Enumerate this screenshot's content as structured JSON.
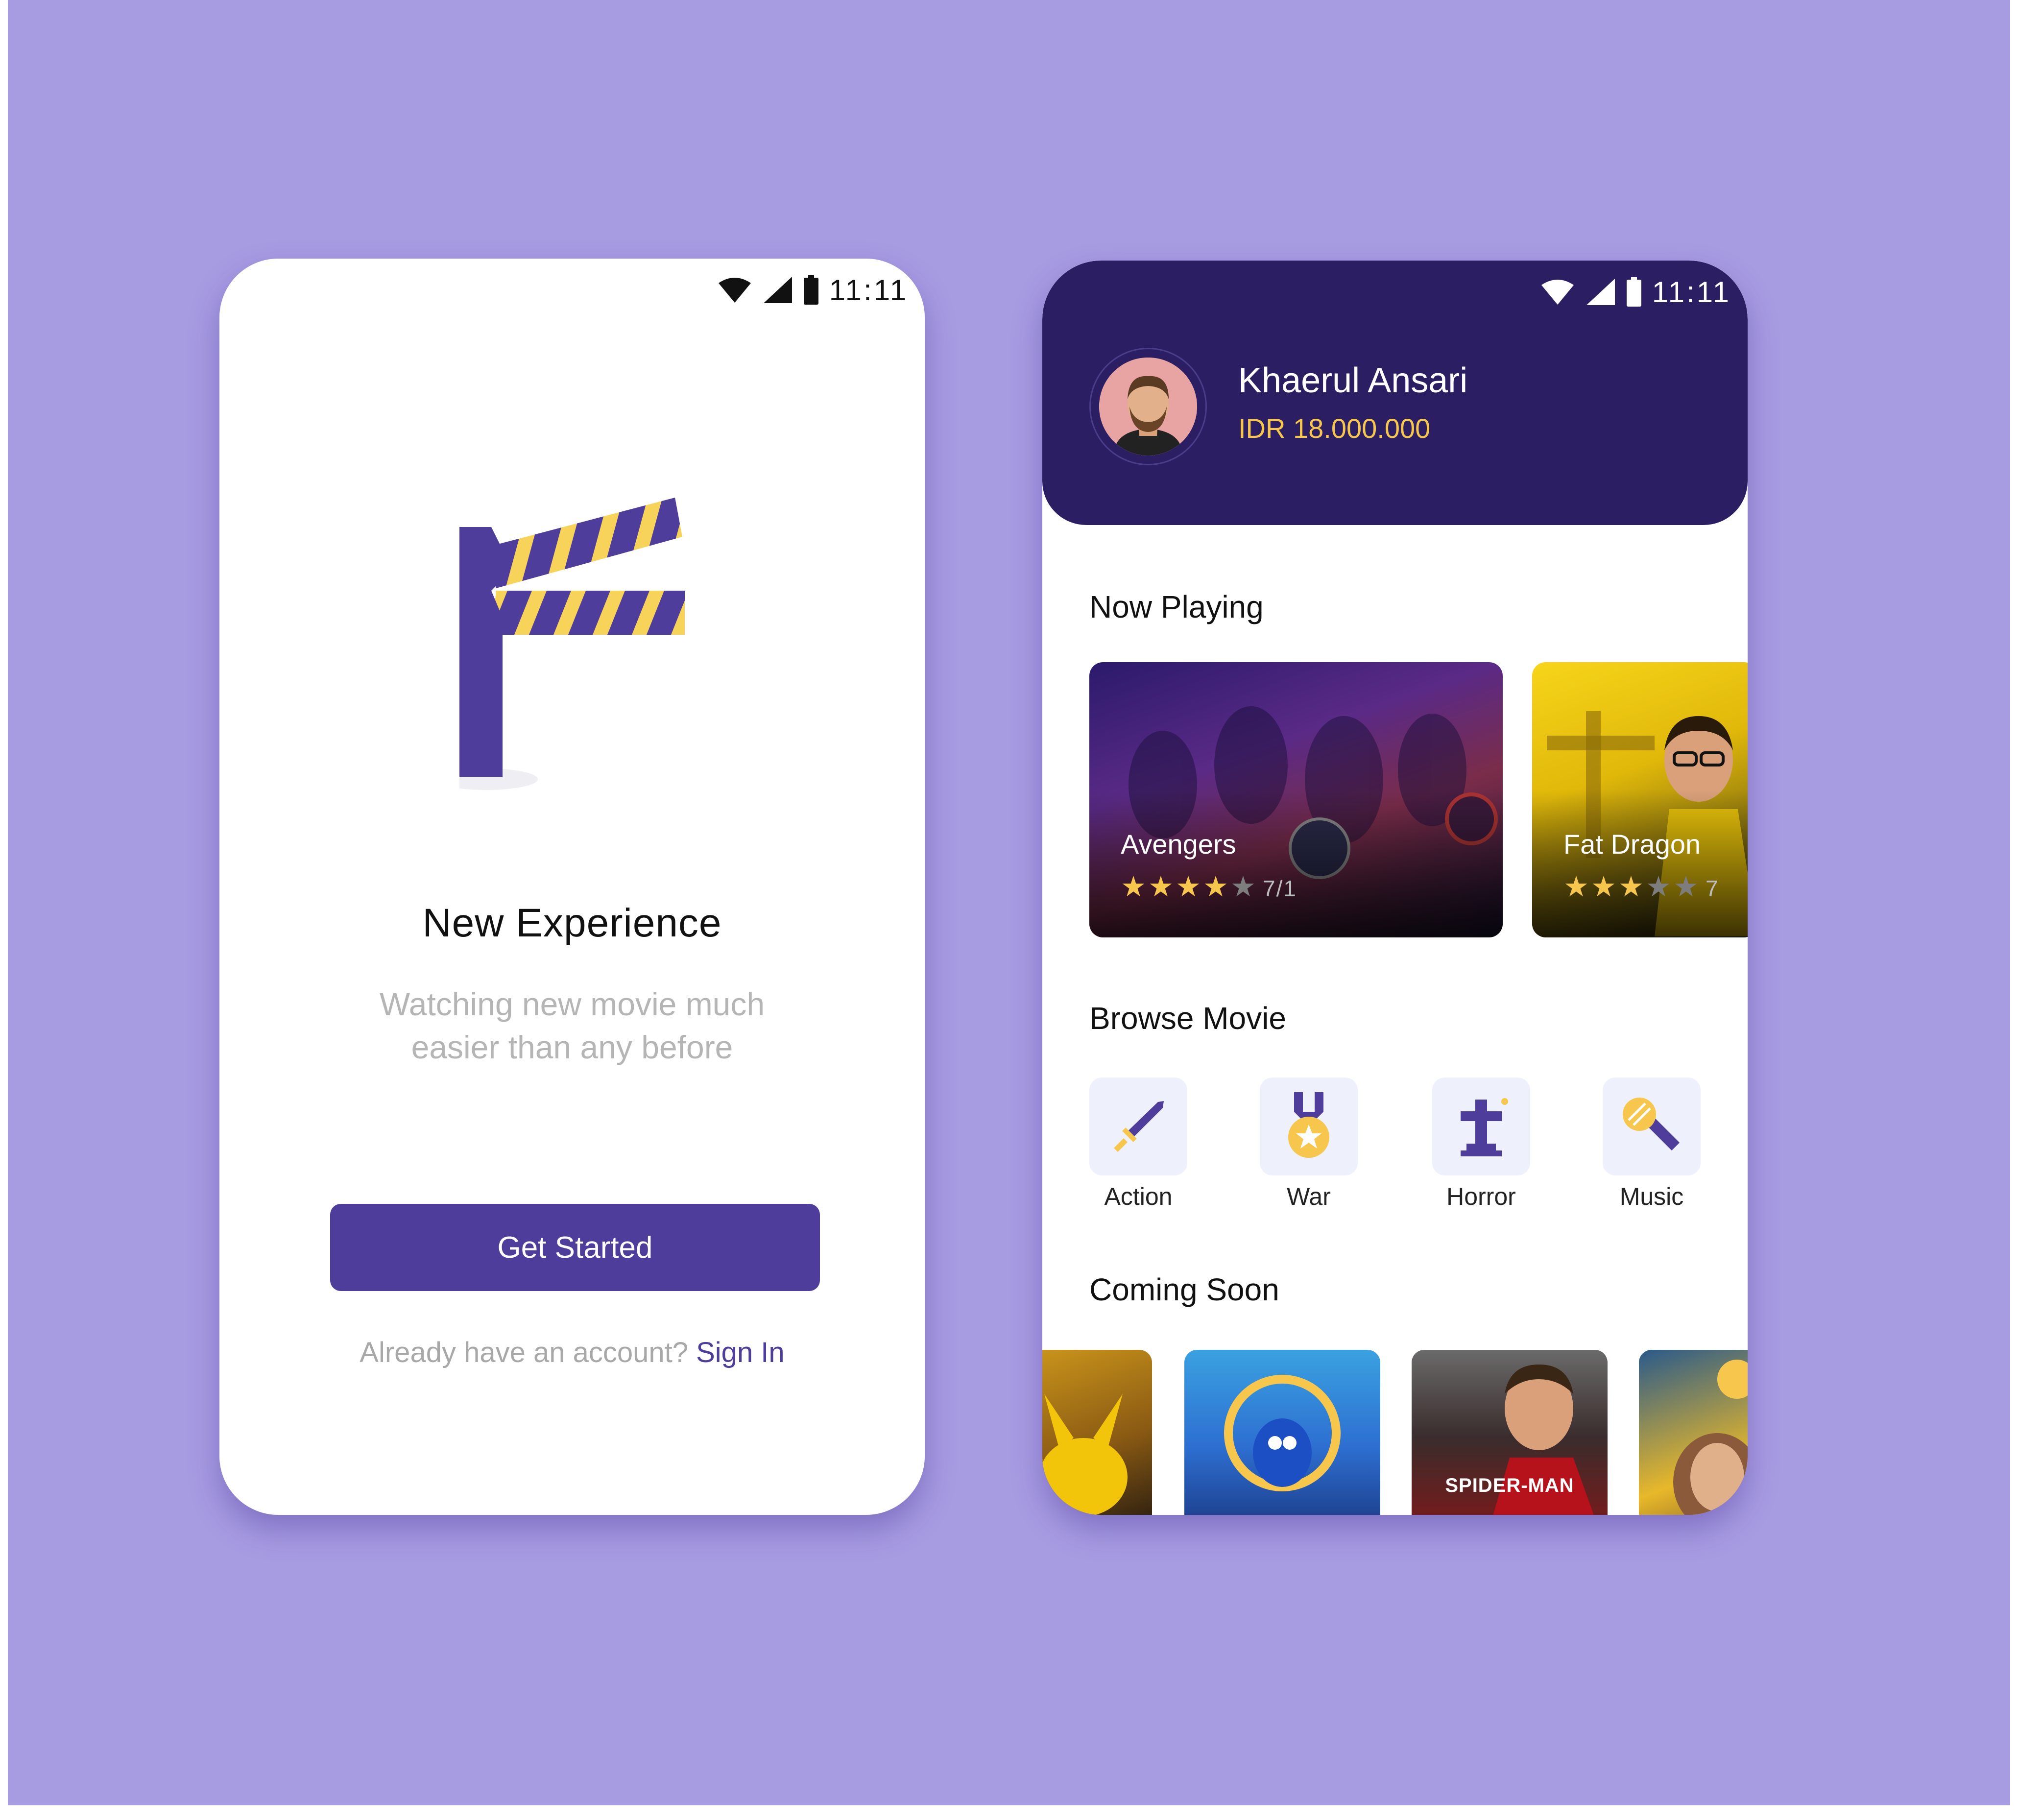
{
  "status_bar": {
    "time": "11:11"
  },
  "onboarding": {
    "headline": "New Experience",
    "subtitle": "Watching new movie much easier than any before",
    "cta_label": "Get Started",
    "signin_prompt": "Already have an account?",
    "signin_link": "Sign In"
  },
  "home": {
    "user": {
      "name": "Khaerul Ansari",
      "balance": "IDR 18.000.000"
    },
    "now_playing": {
      "title": "Now Playing",
      "movies": [
        {
          "title": "Avengers",
          "stars": 4,
          "score": "7/1"
        },
        {
          "title": "Fat Dragon",
          "stars": 3,
          "score": "7"
        }
      ]
    },
    "browse": {
      "title": "Browse Movie",
      "genres": [
        {
          "label": "Action",
          "icon": "sword-icon"
        },
        {
          "label": "War",
          "icon": "medal-icon"
        },
        {
          "label": "Horror",
          "icon": "cross-icon"
        },
        {
          "label": "Music",
          "icon": "microphone-icon"
        }
      ]
    },
    "coming_soon": {
      "title": "Coming Soon",
      "posters": [
        {
          "caption": ""
        },
        {
          "caption": ""
        },
        {
          "caption": "SPIDER-MAN"
        },
        {
          "caption": ""
        }
      ]
    }
  },
  "colors": {
    "background": "#a79be2",
    "primary": "#4f3d9c",
    "header": "#2b1e62",
    "accent": "#f6c74c"
  }
}
